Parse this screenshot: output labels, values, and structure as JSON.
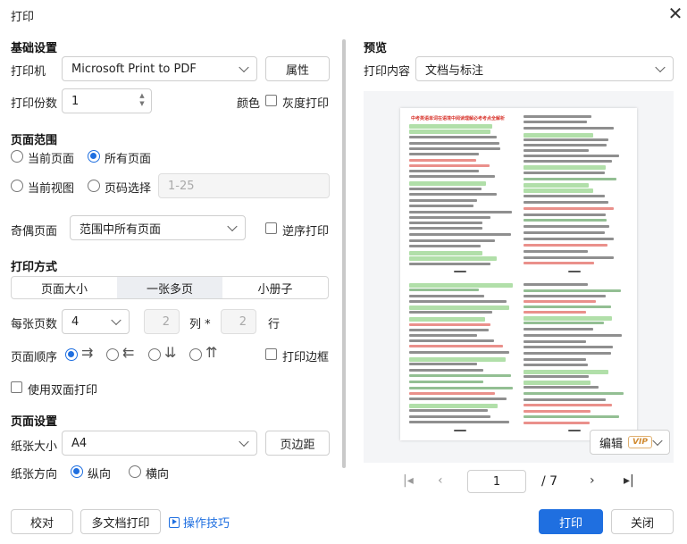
{
  "window": {
    "title": "打印",
    "close_icon": "close-icon"
  },
  "basic": {
    "section": "基础设置",
    "printer_label": "打印机",
    "printer_value": "Microsoft Print to PDF",
    "properties_button": "属性",
    "copies_label": "打印份数",
    "copies_value": "1",
    "color_label": "颜色",
    "grayscale_label": "灰度打印"
  },
  "range": {
    "section": "页面范围",
    "current_page": "当前页面",
    "all_pages": "所有页面",
    "current_view": "当前视图",
    "page_select": "页码选择",
    "page_select_placeholder": "1-25",
    "odd_even_label": "奇偶页面",
    "odd_even_value": "范围中所有页面",
    "reverse_label": "逆序打印"
  },
  "mode": {
    "section": "打印方式",
    "tabs": [
      "页面大小",
      "一张多页",
      "小册子"
    ],
    "pages_per_sheet_label": "每张页数",
    "pages_per_sheet_value": "4",
    "cols_value": "2",
    "cols_label": "列 *",
    "rows_value": "2",
    "rows_label": "行",
    "page_order_label": "页面顺序",
    "print_border_label": "打印边框",
    "duplex_label": "使用双面打印"
  },
  "page_setup": {
    "section": "页面设置",
    "paper_size_label": "纸张大小",
    "paper_size_value": "A4",
    "margins_button": "页边距",
    "orientation_label": "纸张方向",
    "portrait": "纵向",
    "landscape": "横向"
  },
  "footer": {
    "proofread_button": "校对",
    "multi_doc_button": "多文档打印",
    "tips_link": "操作技巧",
    "print_button": "打印",
    "close_button": "关闭"
  },
  "preview": {
    "section": "预览",
    "content_label": "打印内容",
    "content_value": "文档与标注",
    "edit_button": "编辑",
    "vip_badge": "VIP",
    "current_page": "1",
    "total_pages": "/ 7",
    "doc_title": "中考英语单词在语境中阅读理解必考考点全解析"
  },
  "colors": {
    "accent": "#1f6fe0",
    "doc_red": "#d8342c",
    "doc_green": "#3a8a3a",
    "doc_highlight": "#a8dca0"
  }
}
